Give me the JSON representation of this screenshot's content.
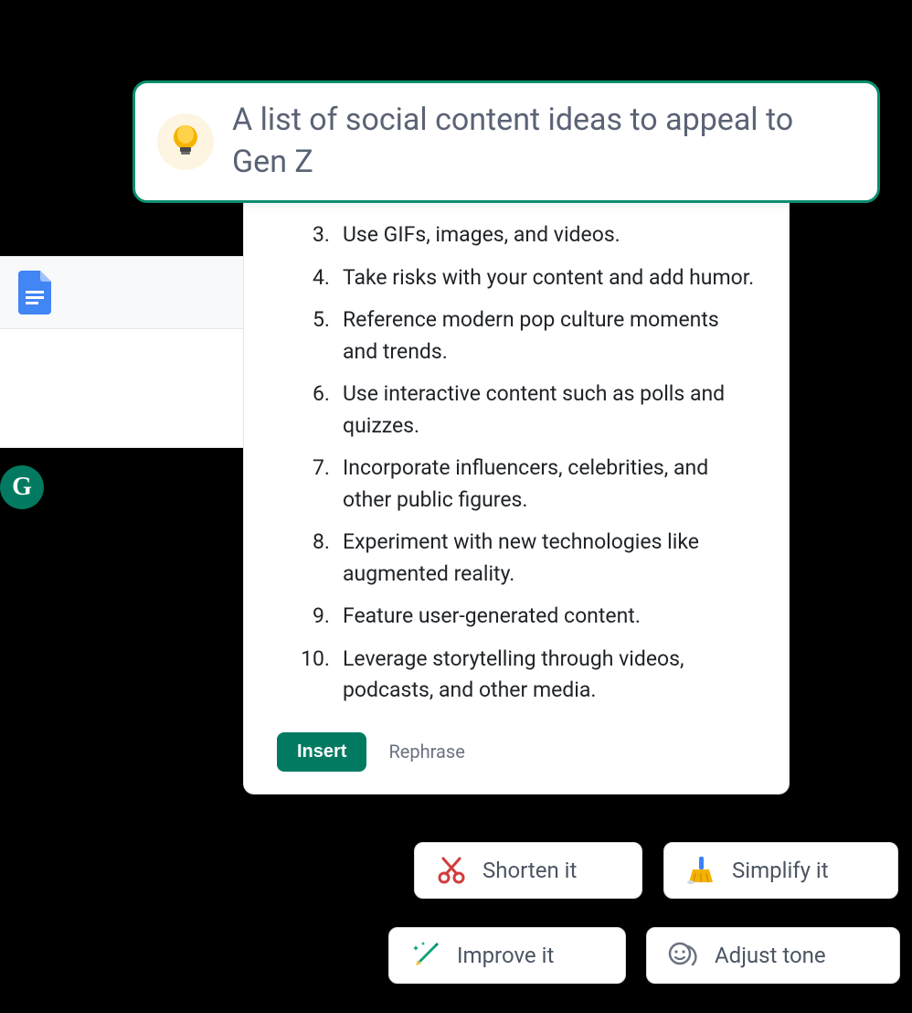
{
  "prompt": {
    "text": "A list of social content ideas to appeal to Gen Z"
  },
  "results": {
    "start_number": 3,
    "items": [
      "Use GIFs, images, and videos.",
      "Take risks with your content and add humor.",
      "Reference modern pop culture moments and trends.",
      "Use interactive content such as polls and quizzes.",
      "Incorporate influencers, celebrities, and other public figures.",
      "Experiment with new technologies like augmented reality.",
      "Feature user-generated content.",
      "Leverage storytelling through videos, podcasts, and other media."
    ]
  },
  "actions": {
    "insert_label": "Insert",
    "rephrase_label": "Rephrase"
  },
  "chips": {
    "shorten": "Shorten it",
    "simplify": "Simplify it",
    "improve": "Improve it",
    "adjust": "Adjust tone"
  },
  "icons": {
    "docs": "docs-icon",
    "grammarly": "G",
    "bulb": "lightbulb-icon",
    "scissors": "scissors-icon",
    "broom": "broom-icon",
    "pencil": "pencil-icon",
    "face": "face-icon"
  },
  "colors": {
    "brand_green": "#027a61",
    "prompt_border": "#0a8f6e",
    "text_muted": "#5a6275"
  }
}
